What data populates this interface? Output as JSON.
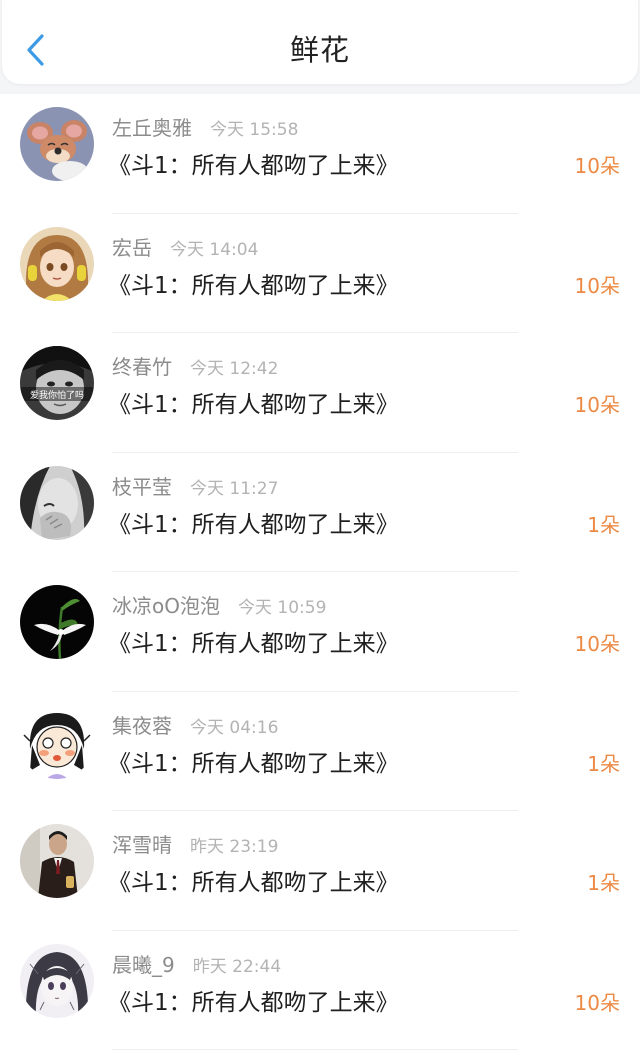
{
  "header": {
    "title": "鲜花",
    "back_icon": "chevron-left-icon",
    "accent_color": "#3d9be6"
  },
  "colors": {
    "amount": "#ec8a45",
    "name": "#8c8c8c",
    "time": "#b3b3b3"
  },
  "records": [
    {
      "name": "左丘奥雅",
      "time": "今天 15:58",
      "book": "《斗1：所有人都吻了上来》",
      "amount": "10朵",
      "avatar": "cartoon-mouse-avatar"
    },
    {
      "name": "宏岳",
      "time": "今天 14:04",
      "book": "《斗1：所有人都吻了上来》",
      "amount": "10朵",
      "avatar": "anime-girl-headphones-avatar"
    },
    {
      "name": "终春竹",
      "time": "今天 12:42",
      "book": "《斗1：所有人都吻了上来》",
      "amount": "10朵",
      "avatar": "bw-photo-avatar",
      "avatar_caption": "爱我你怕了吗"
    },
    {
      "name": "枝平莹",
      "time": "今天 11:27",
      "book": "《斗1：所有人都吻了上来》",
      "amount": "1朵",
      "avatar": "bw-face-avatar"
    },
    {
      "name": "冰凉oO泡泡",
      "time": "今天 10:59",
      "book": "《斗1：所有人都吻了上来》",
      "amount": "10朵",
      "avatar": "white-orchid-avatar"
    },
    {
      "name": "集夜蓉",
      "time": "今天 04:16",
      "book": "《斗1：所有人都吻了上来》",
      "amount": "1朵",
      "avatar": "cartoon-girl-avatar"
    },
    {
      "name": "浑雪晴",
      "time": "昨天 23:19",
      "book": "《斗1：所有人都吻了上来》",
      "amount": "1朵",
      "avatar": "man-suit-avatar"
    },
    {
      "name": "晨曦_9",
      "time": "昨天 22:44",
      "book": "《斗1：所有人都吻了上来》",
      "amount": "10朵",
      "avatar": "anime-sketch-avatar"
    }
  ]
}
